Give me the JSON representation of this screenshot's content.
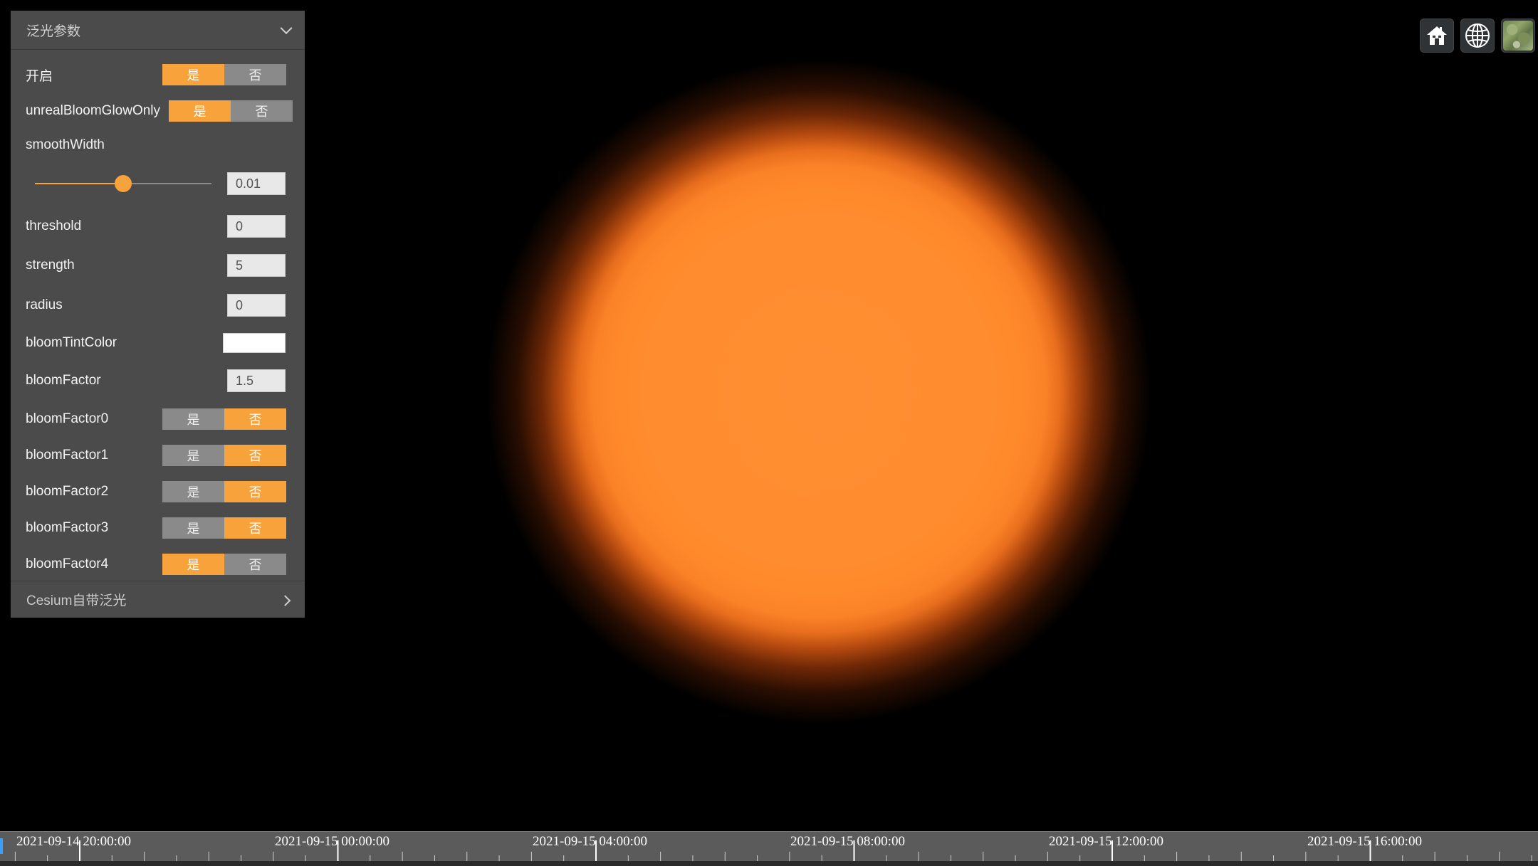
{
  "panel": {
    "title": "泛光参数",
    "footer_title": "Cesium自带泛光",
    "yes_label": "是",
    "no_label": "否",
    "rows": {
      "enable": {
        "label": "开启",
        "value": "是"
      },
      "glow_only": {
        "label": "unrealBloomGlowOnly",
        "value": "是"
      },
      "smooth_width": {
        "label": "smoothWidth",
        "value": "0.01",
        "slider_fraction": 0.5
      },
      "threshold": {
        "label": "threshold",
        "value": "0"
      },
      "strength": {
        "label": "strength",
        "value": "5"
      },
      "radius": {
        "label": "radius",
        "value": "0"
      },
      "tint_color": {
        "label": "bloomTintColor",
        "value": "#ffffff"
      },
      "bloom_factor": {
        "label": "bloomFactor",
        "value": "1.5"
      },
      "bloom_factor0": {
        "label": "bloomFactor0",
        "value": "否"
      },
      "bloom_factor1": {
        "label": "bloomFactor1",
        "value": "否"
      },
      "bloom_factor2": {
        "label": "bloomFactor2",
        "value": "否"
      },
      "bloom_factor3": {
        "label": "bloomFactor3",
        "value": "否"
      },
      "bloom_factor4": {
        "label": "bloomFactor4",
        "value": "是"
      }
    }
  },
  "toolbar": {
    "home_icon": "home-icon",
    "globe_icon": "globe-icon",
    "imagery_icon": "imagery-picker-icon"
  },
  "timeline": {
    "labels": [
      "2021-09-14 20:00:00",
      "2021-09-15 00:00:00",
      "2021-09-15 04:00:00",
      "2021-09-15 08:00:00",
      "2021-09-15 12:00:00",
      "2021-09-15 16:00:00"
    ]
  },
  "colors": {
    "accent": "#f7a23b",
    "panel_bg": "#4b4b4b",
    "glow": "#ff8d30"
  }
}
